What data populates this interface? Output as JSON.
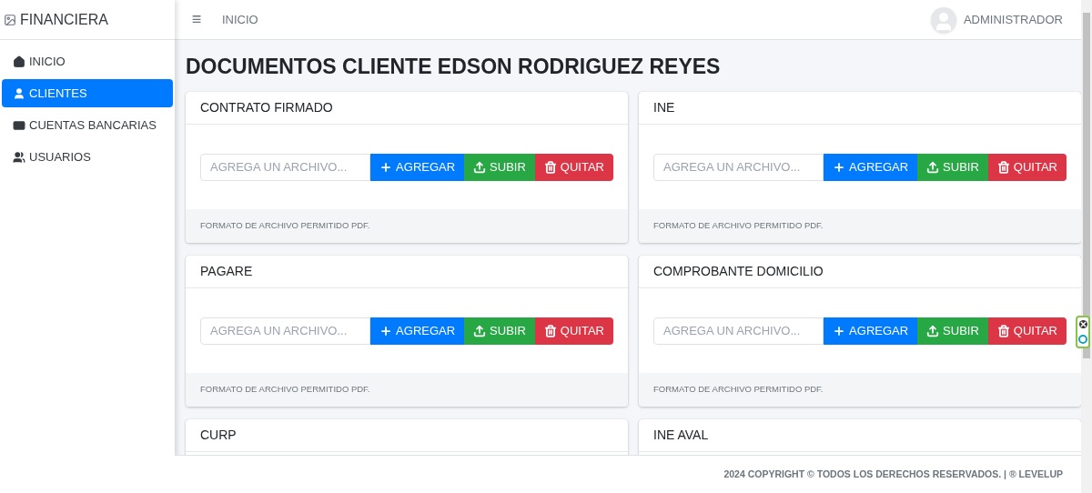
{
  "brand": {
    "name": "FINANCIERA"
  },
  "sidebar": {
    "items": [
      {
        "label": "INICIO",
        "selected": false
      },
      {
        "label": "CLIENTES",
        "selected": true
      },
      {
        "label": "CUENTAS BANCARIAS",
        "selected": false
      },
      {
        "label": "USUARIOS",
        "selected": false
      }
    ]
  },
  "header": {
    "menu_icon": "≡",
    "breadcrumb": "INICIO",
    "user": "ADMINISTRADOR"
  },
  "page_title": "DOCUMENTOS CLIENTE EDSON RODRIGUEZ REYES",
  "cards": [
    {
      "title": "CONTRATO FIRMADO",
      "placeholder": "AGREGA UN ARCHIVO...",
      "buttons": [
        {
          "kind": "add",
          "label": "AGREGAR"
        },
        {
          "kind": "upload",
          "label": "SUBIR"
        },
        {
          "kind": "remove",
          "label": "QUITAR"
        }
      ],
      "note": "FORMATO DE ARCHIVO PERMITIDO PDF."
    },
    {
      "title": "INE",
      "placeholder": "AGREGA UN ARCHIVO...",
      "buttons": [
        {
          "kind": "add",
          "label": "AGREGAR"
        },
        {
          "kind": "upload",
          "label": "SUBIR"
        },
        {
          "kind": "remove",
          "label": "QUITAR"
        }
      ],
      "note": "FORMATO DE ARCHIVO PERMITIDO PDF."
    },
    {
      "title": "PAGARE",
      "placeholder": "AGREGA UN ARCHIVO...",
      "buttons": [
        {
          "kind": "add",
          "label": "AGREGAR"
        },
        {
          "kind": "upload",
          "label": "SUBIR"
        },
        {
          "kind": "remove",
          "label": "QUITAR"
        }
      ],
      "note": "FORMATO DE ARCHIVO PERMITIDO PDF."
    },
    {
      "title": "COMPROBANTE DOMICILIO",
      "placeholder": "AGREGA UN ARCHIVO...",
      "buttons": [
        {
          "kind": "add",
          "label": "AGREGAR"
        },
        {
          "kind": "upload",
          "label": "SUBIR"
        },
        {
          "kind": "remove",
          "label": "QUITAR"
        }
      ],
      "note": "FORMATO DE ARCHIVO PERMITIDO PDF."
    },
    {
      "title": "CURP"
    },
    {
      "title": "INE AVAL"
    }
  ],
  "footer": "2024 COPYRIGHT © TODOS LOS DERECHOS RESERVADOS. | ® LEVELUP"
}
